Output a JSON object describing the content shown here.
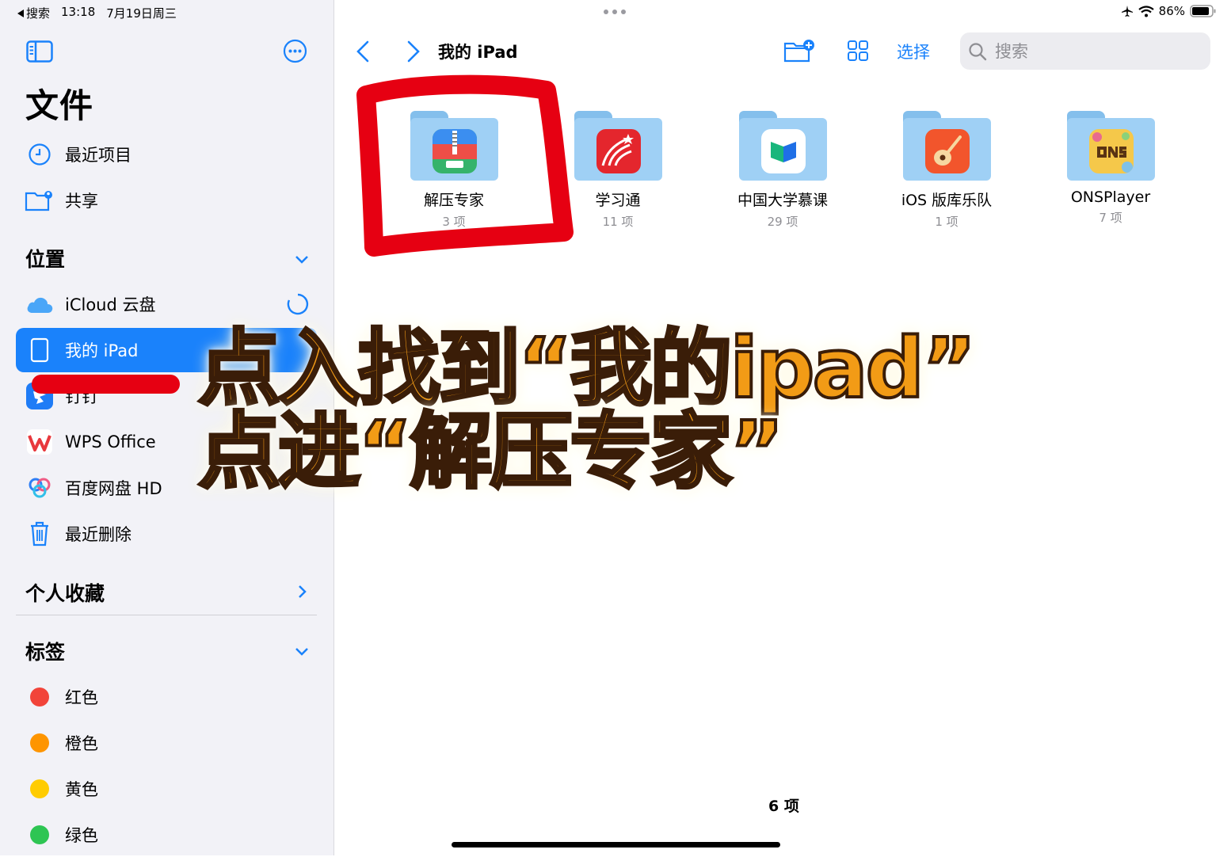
{
  "status": {
    "back_app": "搜索",
    "time": "13:18",
    "date": "7月19日周三",
    "battery": "86%"
  },
  "sidebar": {
    "title": "文件",
    "top_items": [
      {
        "label": "最近项目",
        "icon": "clock-icon"
      },
      {
        "label": "共享",
        "icon": "shared-folder-icon"
      }
    ],
    "locations_header": "位置",
    "locations": [
      {
        "label": "iCloud 云盘",
        "icon": "icloud-icon"
      },
      {
        "label": "我的 iPad",
        "icon": "ipad-icon",
        "selected": true
      },
      {
        "label": "钉钉",
        "icon": "dingtalk-icon"
      },
      {
        "label": "WPS Office",
        "icon": "wps-icon"
      },
      {
        "label": "百度网盘 HD",
        "icon": "baidu-netdisk-icon"
      },
      {
        "label": "最近删除",
        "icon": "trash-icon"
      }
    ],
    "favorites_header": "个人收藏",
    "tags_header": "标签",
    "tags": [
      {
        "label": "红色",
        "color": "#f2443a"
      },
      {
        "label": "橙色",
        "color": "#fe9500"
      },
      {
        "label": "黄色",
        "color": "#ffcc01"
      },
      {
        "label": "绿色",
        "color": "#2ec553"
      }
    ]
  },
  "toolbar": {
    "location_title": "我的 iPad",
    "select_label": "选择",
    "search_placeholder": "搜索"
  },
  "files": [
    {
      "name": "解压专家",
      "count": "3 项",
      "app": "zip-app-icon"
    },
    {
      "name": "学习通",
      "count": "11 项",
      "app": "xuexitong-app-icon"
    },
    {
      "name": "中国大学慕课",
      "count": "29 项",
      "app": "mooc-app-icon"
    },
    {
      "name": "iOS 版库乐队",
      "count": "1 项",
      "app": "garageband-app-icon"
    },
    {
      "name": "ONSPlayer",
      "count": "7 项",
      "app": "onsplayer-app-icon"
    }
  ],
  "footer": {
    "item_count": "6 项"
  },
  "annotation": {
    "line1": "点入找到“我的ipad”",
    "line2": "点进“解压专家”"
  },
  "colors": {
    "accent": "#1a82fb",
    "annotation_red": "#e60012",
    "annotation_text": "#f29b16"
  }
}
